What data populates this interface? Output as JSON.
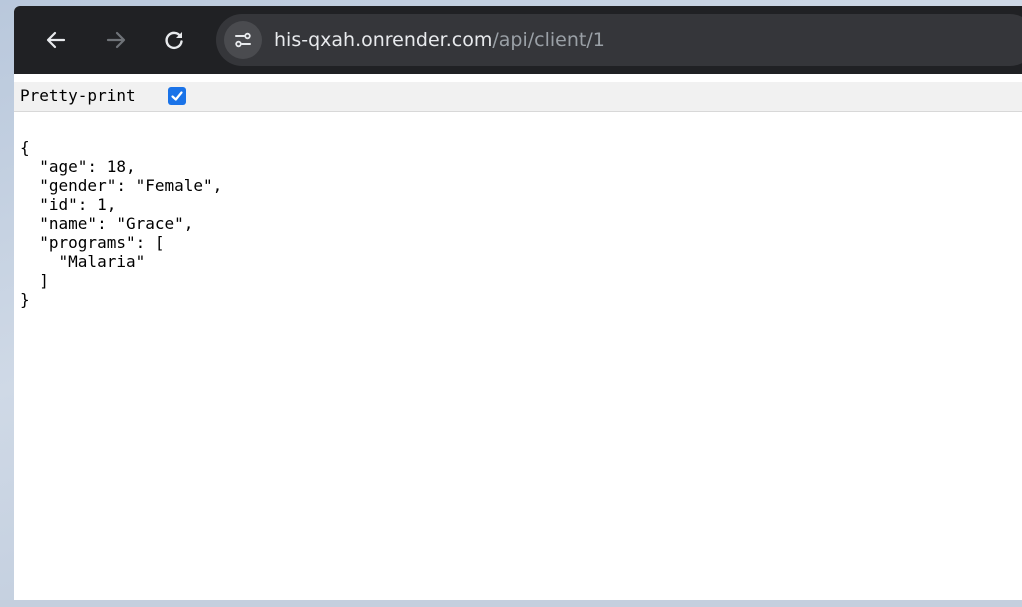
{
  "browser": {
    "url_host": "his-qxah.onrender.com",
    "url_path": "/api/client/1",
    "icons": {
      "back": "back-arrow-icon",
      "forward": "forward-arrow-icon",
      "reload": "reload-icon",
      "site_info": "site-settings-icon"
    }
  },
  "viewer": {
    "pretty_print_label": "Pretty-print",
    "pretty_print_checked": true,
    "json_lines": [
      "{",
      "  \"age\": 18,",
      "  \"gender\": \"Female\",",
      "  \"id\": 1,",
      "  \"name\": \"Grace\",",
      "  \"programs\": [",
      "    \"Malaria\"",
      "  ]",
      "}"
    ]
  },
  "colors": {
    "toolbar": "#202124",
    "omnibox": "#35363a",
    "checkbox": "#1a73e8"
  }
}
